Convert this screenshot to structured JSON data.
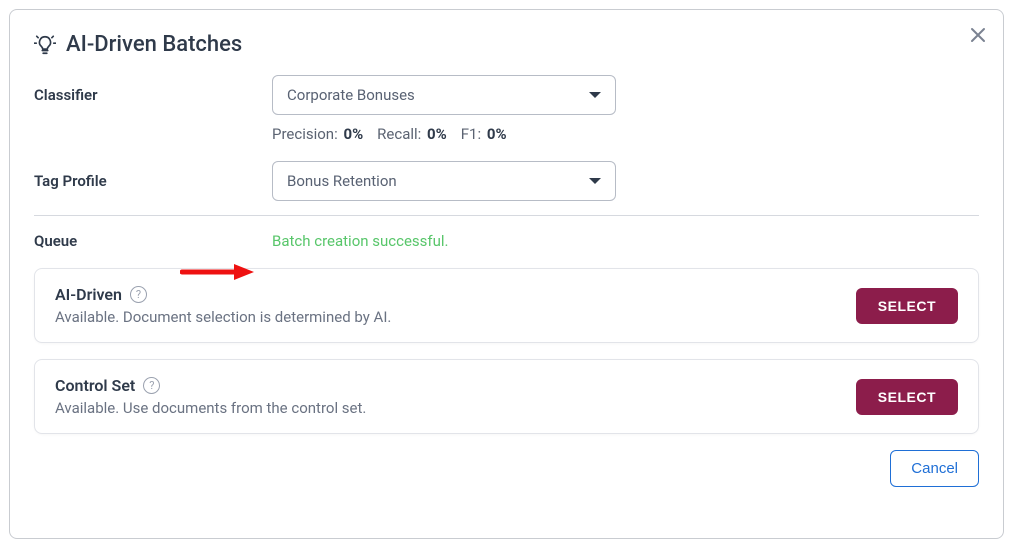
{
  "modal": {
    "title": "AI-Driven Batches",
    "classifier": {
      "label": "Classifier",
      "selected": "Corporate Bonuses",
      "metrics": {
        "precision_label": "Precision:",
        "precision_value": "0%",
        "recall_label": "Recall:",
        "recall_value": "0%",
        "f1_label": "F1:",
        "f1_value": "0%"
      }
    },
    "tag_profile": {
      "label": "Tag Profile",
      "selected": "Bonus Retention"
    },
    "queue": {
      "label": "Queue",
      "success_message": "Batch creation successful."
    },
    "cards": [
      {
        "title": "AI-Driven",
        "description": "Available. Document selection is determined by AI.",
        "button": "SELECT"
      },
      {
        "title": "Control Set",
        "description": "Available. Use documents from the control set.",
        "button": "SELECT"
      }
    ],
    "cancel": "Cancel"
  }
}
